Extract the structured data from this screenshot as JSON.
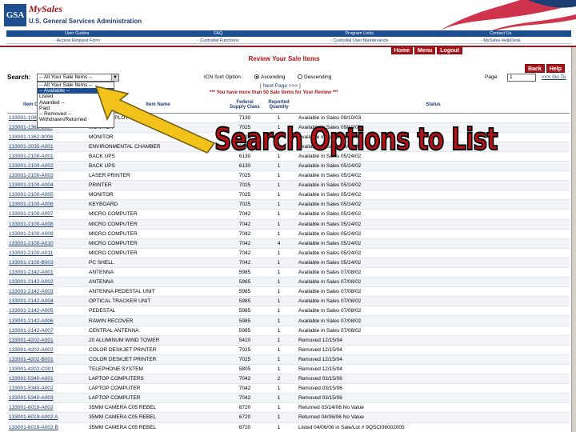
{
  "header": {
    "logo_text": "GSA",
    "brand_title": "MySales",
    "agency_name": "U.S. General Services Administration"
  },
  "nav_primary": [
    "User Guides",
    "FAQ",
    "Program Links",
    "Contact Us"
  ],
  "nav_secondary": [
    "- Access Request Form",
    "- Custodial Functions",
    "- Custodial User Maintenance",
    "- MySales HelpDesk"
  ],
  "top_buttons": [
    "Home",
    "Menu",
    "Logout"
  ],
  "page_title": "Review Your Sale Items",
  "right_buttons": [
    "Back",
    "Help"
  ],
  "search": {
    "label": "Search:",
    "selected_value": "-- All Your Sale Items --",
    "options": [
      "-- All Your Sale Items --",
      "-- Available --",
      "Listed",
      "Awarded --",
      "Paid",
      "-- Removed --",
      "Withdrawn/Returned"
    ],
    "sort_label": "ICN Sort Option :",
    "sort_ascending": "Ascending",
    "sort_descending": "Descending",
    "page_label": "Page:",
    "page_value": "1",
    "goto_label": "<<< Go To"
  },
  "next_page": "[ Next Page >>> ]",
  "warning": "*** You have more than 50 Sale Items for Your Review ***",
  "table": {
    "headers": [
      "Item Control Number",
      "Item Name",
      "Federal Supply Class",
      "Reported Quantity",
      "Status"
    ],
    "rows": [
      [
        "133001-1082-B001",
        "FLAT BED PLOTTER",
        "7130",
        "1",
        "Available in Sales 09/10/03"
      ],
      [
        "133001-1362-8007",
        "MONITOR",
        "7025",
        "1",
        "Available in Sales 09/10/03"
      ],
      [
        "133001-1362-8008",
        "MONITOR",
        "7025",
        "1",
        "Available in Sales 09/10/03"
      ],
      [
        "133001-2035-A001",
        "ENVIRONMENTAL CHAMBER",
        "6640",
        "1",
        "Available in Sales 09/10/03"
      ],
      [
        "133001-2100-A001",
        "BACK UPS",
        "6130",
        "1",
        "Available in Sales 05/24/02"
      ],
      [
        "133001-2100-A002",
        "BACK UPS",
        "6130",
        "1",
        "Available in Sales 05/24/02"
      ],
      [
        "133001-2100-A003",
        "LASER PRINTER",
        "7025",
        "1",
        "Available in Sales 05/24/02"
      ],
      [
        "133001-2100-A004",
        "PRINTER",
        "7025",
        "1",
        "Available in Sales 05/24/02"
      ],
      [
        "133001-2100-A005",
        "MONITOR",
        "7025",
        "1",
        "Available in Sales 05/24/02"
      ],
      [
        "133001-2100-A006",
        "KEYBOARD",
        "7025",
        "1",
        "Available in Sales 05/24/02"
      ],
      [
        "133001-2100-A007",
        "MICRO COMPUTER",
        "7042",
        "1",
        "Available in Sales 05/24/02"
      ],
      [
        "133001-2100-A008",
        "MICRO COMPUTER",
        "7042",
        "1",
        "Available in Sales 05/24/02"
      ],
      [
        "133001-2100-A009",
        "MICRO COMPUTER",
        "7042",
        "1",
        "Available in Sales 05/24/02"
      ],
      [
        "133001-2100-A010",
        "MICRO COMPUTER",
        "7042",
        "4",
        "Available in Sales 05/24/02"
      ],
      [
        "133001-2100-A011",
        "MICRO COMPUTER",
        "7042",
        "1",
        "Available in Sales 05/24/02"
      ],
      [
        "133001-2100-B003",
        "PC SHELL",
        "7042",
        "1",
        "Available in Sales 05/24/02"
      ],
      [
        "133001-2142-A001",
        "ANTENNA",
        "5985",
        "1",
        "Available in Sales 07/08/02"
      ],
      [
        "133001-2142-A002",
        "ANTENNA",
        "5985",
        "1",
        "Available in Sales 07/08/02"
      ],
      [
        "133001-2142-A003",
        "ANTENNA PEDESTAL UNIT",
        "5985",
        "1",
        "Available in Sales 07/08/02"
      ],
      [
        "133001-2142-A004",
        "OPTICAL TRACKER UNIT",
        "5985",
        "1",
        "Available in Sales 07/08/02"
      ],
      [
        "133001-2142-A005",
        "PEDESTAL",
        "5985",
        "1",
        "Available in Sales 07/08/02"
      ],
      [
        "133001-2142-A006",
        "RAWIN RECOVER",
        "5985",
        "1",
        "Available in Sales 07/08/02"
      ],
      [
        "133001-2142-A007",
        "CENTRAL ANTENNA",
        "5985",
        "1",
        "Available in Sales 07/08/02"
      ],
      [
        "133001-4202-A001",
        "20 ALUMINUM WIND TOWER",
        "5410",
        "1",
        "Removed 12/15/04"
      ],
      [
        "133001-4202-A002",
        "COLOR DESKJET PRINTER",
        "7025",
        "1",
        "Removed 12/15/04"
      ],
      [
        "133001-4202-B001",
        "COLOR DESKJET PRINTER",
        "7025",
        "1",
        "Removed 12/15/04"
      ],
      [
        "133001-4202-C001",
        "TELEPHONE SYSTEM",
        "5805",
        "1",
        "Removed 12/15/04"
      ],
      [
        "133001-5340-A001",
        "LAPTOP COMPUTERS",
        "7042",
        "2",
        "Removed 03/15/06"
      ],
      [
        "133001-5340-A002",
        "LAPTOP COMPUTER",
        "7042",
        "1",
        "Removed 03/15/06"
      ],
      [
        "133001-5340-A003",
        "LAPTOP COMPUTER",
        "7042",
        "1",
        "Removed 03/15/06"
      ],
      [
        "133001-6019-A002",
        "35MM CAMERA C05 REBEL",
        "6720",
        "1",
        "Returned 03/14/06 No Value"
      ],
      [
        "133001-6019-A002 A",
        "35MM CAMERA C05 REBEL",
        "6720",
        "1",
        "Returned 04/06/06 No Value"
      ],
      [
        "133001-6019-A002 B",
        "35MM CAMERA C05 REBEL",
        "6720",
        "1",
        "Listed 04/06/06 in Sale/Lot # 9QSCI06002005"
      ]
    ]
  },
  "annotation": {
    "text": "Search Options to List",
    "text_color": "#b31216",
    "arrow_color": "#f2c21b"
  },
  "colors": {
    "brand_blue": "#1d4e8f",
    "brand_red": "#a8151b"
  }
}
